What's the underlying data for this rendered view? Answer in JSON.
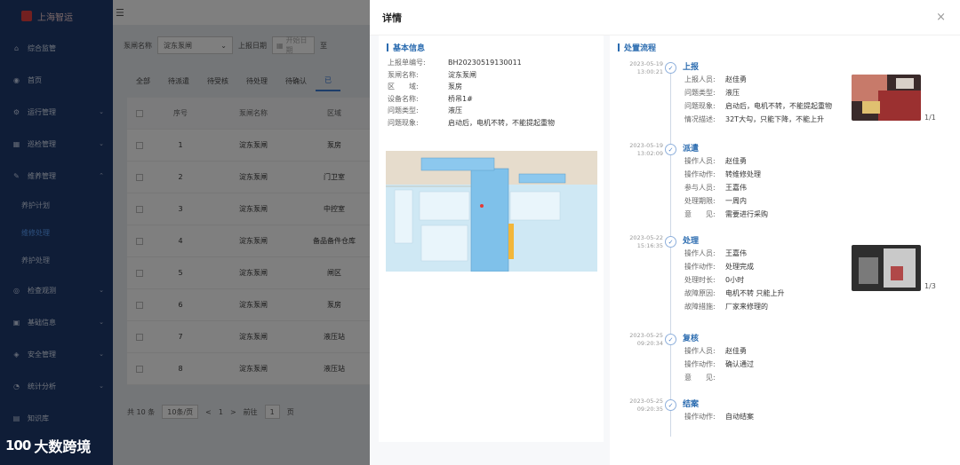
{
  "sidebar": {
    "logo_text": "上海智运",
    "items": [
      {
        "label": "综合监管",
        "icon": "home-icon"
      },
      {
        "label": "首页",
        "icon": "dashboard-icon"
      },
      {
        "label": "运行管理",
        "icon": "settings-icon"
      },
      {
        "label": "巡检管理",
        "icon": "inspect-icon"
      },
      {
        "label": "维养管理",
        "icon": "wrench-icon"
      }
    ],
    "sub_items": [
      {
        "label": "养护计划"
      },
      {
        "label": "维修处理"
      },
      {
        "label": "养护处理"
      }
    ],
    "items_after": [
      {
        "label": "检查观测",
        "icon": "location-icon"
      },
      {
        "label": "基础信息",
        "icon": "info-icon"
      },
      {
        "label": "安全管理",
        "icon": "shield-icon"
      },
      {
        "label": "统计分析",
        "icon": "chart-icon"
      },
      {
        "label": "知识库",
        "icon": "book-icon"
      }
    ]
  },
  "filter": {
    "label_station": "泵闸名称",
    "station_value": "淀东泵闸",
    "label_date": "上报日期",
    "date_start_placeholder": "开始日期",
    "date_sep": "至"
  },
  "tabs": [
    "全部",
    "待派遣",
    "待受核",
    "待处理",
    "待确认",
    "已"
  ],
  "table": {
    "headers": {
      "no": "序号",
      "name": "泵闸名称",
      "loc": "区域"
    },
    "rows": [
      {
        "no": "1",
        "name": "淀东泵闸",
        "loc": "泵房"
      },
      {
        "no": "2",
        "name": "淀东泵闸",
        "loc": "门卫室"
      },
      {
        "no": "3",
        "name": "淀东泵闸",
        "loc": "中控室"
      },
      {
        "no": "4",
        "name": "淀东泵闸",
        "loc": "备品备件仓库"
      },
      {
        "no": "5",
        "name": "淀东泵闸",
        "loc": "闸区"
      },
      {
        "no": "6",
        "name": "淀东泵闸",
        "loc": "泵房"
      },
      {
        "no": "7",
        "name": "淀东泵闸",
        "loc": "液压站"
      },
      {
        "no": "8",
        "name": "淀东泵闸",
        "loc": "液压站"
      }
    ]
  },
  "pager": {
    "total": "共 10 条",
    "page_size": "10条/页",
    "prev": "<",
    "page": "1",
    "next": ">",
    "goto": "前往",
    "goto_page": "1",
    "page_unit": "页"
  },
  "watermark": {
    "logo": "100",
    "text": "大数跨境"
  },
  "drawer": {
    "title": "详情",
    "close": "×",
    "basic": {
      "title": "基本信息",
      "rows": [
        {
          "label": "上报单编号:",
          "value": "BH20230519130011"
        },
        {
          "label": "泵闸名称:",
          "value": "淀东泵闸"
        },
        {
          "label": "区　　域:",
          "value": "泵房"
        },
        {
          "label": "设备名称:",
          "value": "桥吊1#"
        },
        {
          "label": "问题类型:",
          "value": "液压"
        },
        {
          "label": "问题现象:",
          "value": "启动后，电机不转，不能提起重物"
        }
      ]
    },
    "process": {
      "title": "处置流程",
      "steps": [
        {
          "date": "2023-05-19",
          "time": "13:00:21",
          "title": "上报",
          "rows": [
            {
              "label": "上报人员:",
              "value": "赵佳勇"
            },
            {
              "label": "问题类型:",
              "value": "液压"
            },
            {
              "label": "问题现象:",
              "value": "启动后，电机不转，不能提起重物"
            },
            {
              "label": "情况描述:",
              "value": "32T大勾，只能下降，不能上升"
            }
          ],
          "photo_count": "1/1"
        },
        {
          "date": "2023-05-19",
          "time": "13:02:09",
          "title": "派遣",
          "rows": [
            {
              "label": "操作人员:",
              "value": "赵佳勇"
            },
            {
              "label": "操作动作:",
              "value": "转维修处理"
            },
            {
              "label": "参与人员:",
              "value": "王嘉伟"
            },
            {
              "label": "处理期限:",
              "value": "一周内"
            },
            {
              "label": "意　　见:",
              "value": "需要进行采购"
            }
          ]
        },
        {
          "date": "2023-05-22",
          "time": "15:16:35",
          "title": "处理",
          "rows": [
            {
              "label": "操作人员:",
              "value": "王嘉伟"
            },
            {
              "label": "操作动作:",
              "value": "处理完成"
            },
            {
              "label": "处理时长:",
              "value": "0小时"
            },
            {
              "label": "故障原因:",
              "value": "电机不转 只能上升"
            },
            {
              "label": "故障措施:",
              "value": "厂家来修理的"
            }
          ],
          "photo_count": "1/3"
        },
        {
          "date": "2023-05-25",
          "time": "09:20:34",
          "title": "复核",
          "rows": [
            {
              "label": "操作人员:",
              "value": "赵佳勇"
            },
            {
              "label": "操作动作:",
              "value": "确认通过"
            },
            {
              "label": "意　　见:",
              "value": ""
            }
          ]
        },
        {
          "date": "2023-05-25",
          "time": "09:20:35",
          "title": "结案",
          "rows": [
            {
              "label": "操作动作:",
              "value": "自动结案"
            }
          ]
        }
      ]
    }
  }
}
